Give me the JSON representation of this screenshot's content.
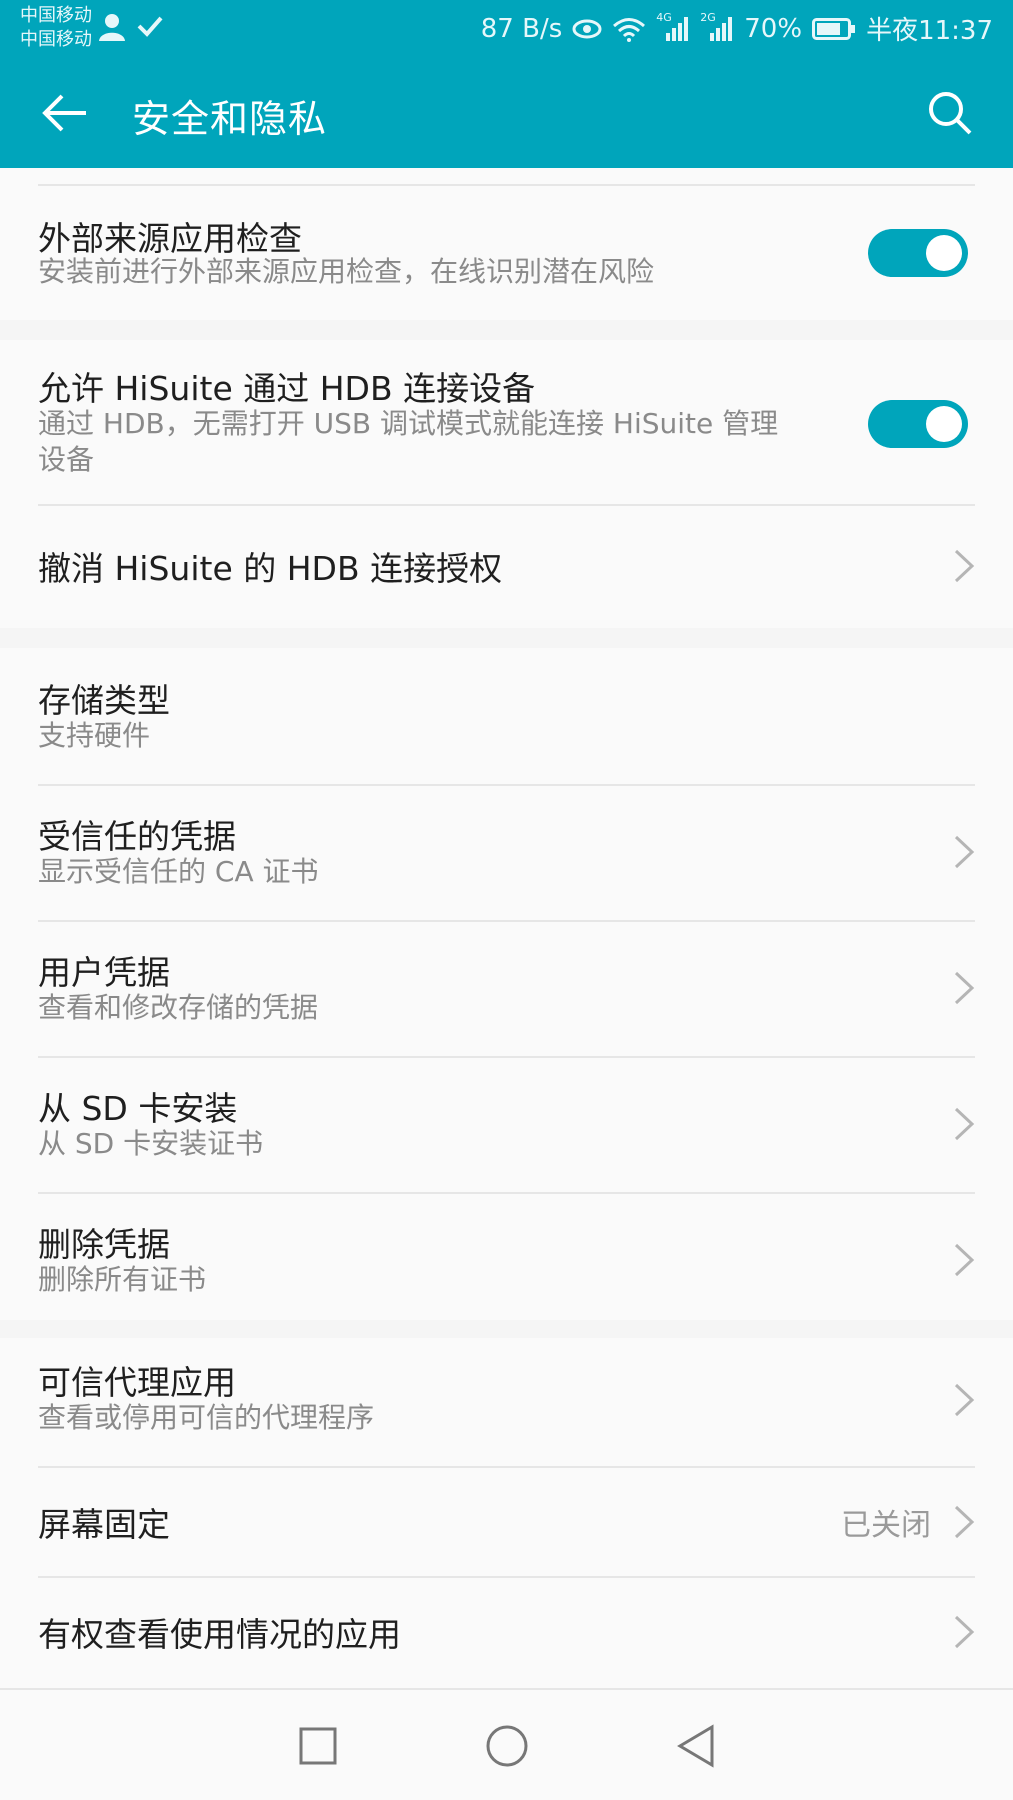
{
  "status_bar": {
    "carrier_1": "中国移动",
    "carrier_2": "中国移动",
    "net_speed": "87 B/s",
    "signal_1_label": "4G",
    "signal_2_label": "2G",
    "battery": "70%",
    "time": "半夜11:37"
  },
  "app_bar": {
    "title": "安全和隐私"
  },
  "settings": {
    "external_source_check": {
      "title": "外部来源应用检查",
      "subtitle": "安装前进行外部来源应用检查，在线识别潜在风险",
      "enabled": true
    },
    "hisuite_hdb": {
      "title": "允许 HiSuite 通过 HDB 连接设备",
      "subtitle_line1": "通过 HDB，无需打开 USB 调试模式就能连接 HiSuite 管理",
      "subtitle_line2": "设备",
      "enabled": true
    },
    "revoke_hdb": {
      "title": "撤消 HiSuite 的 HDB 连接授权"
    },
    "storage_type": {
      "title": "存储类型",
      "subtitle": "支持硬件"
    },
    "trusted_credentials": {
      "title": "受信任的凭据",
      "subtitle": "显示受信任的 CA 证书"
    },
    "user_credentials": {
      "title": "用户凭据",
      "subtitle": "查看和修改存储的凭据"
    },
    "install_from_sd": {
      "title": "从 SD 卡安装",
      "subtitle": "从 SD 卡安装证书"
    },
    "clear_credentials": {
      "title": "删除凭据",
      "subtitle": "删除所有证书"
    },
    "trust_agents": {
      "title": "可信代理应用",
      "subtitle": "查看或停用可信的代理程序"
    },
    "screen_pinning": {
      "title": "屏幕固定",
      "value": "已关闭"
    },
    "usage_access": {
      "title": "有权查看使用情况的应用"
    }
  },
  "colors": {
    "accent": "#00a5bb",
    "background": "#f5f5f5",
    "card": "#fafafa"
  }
}
